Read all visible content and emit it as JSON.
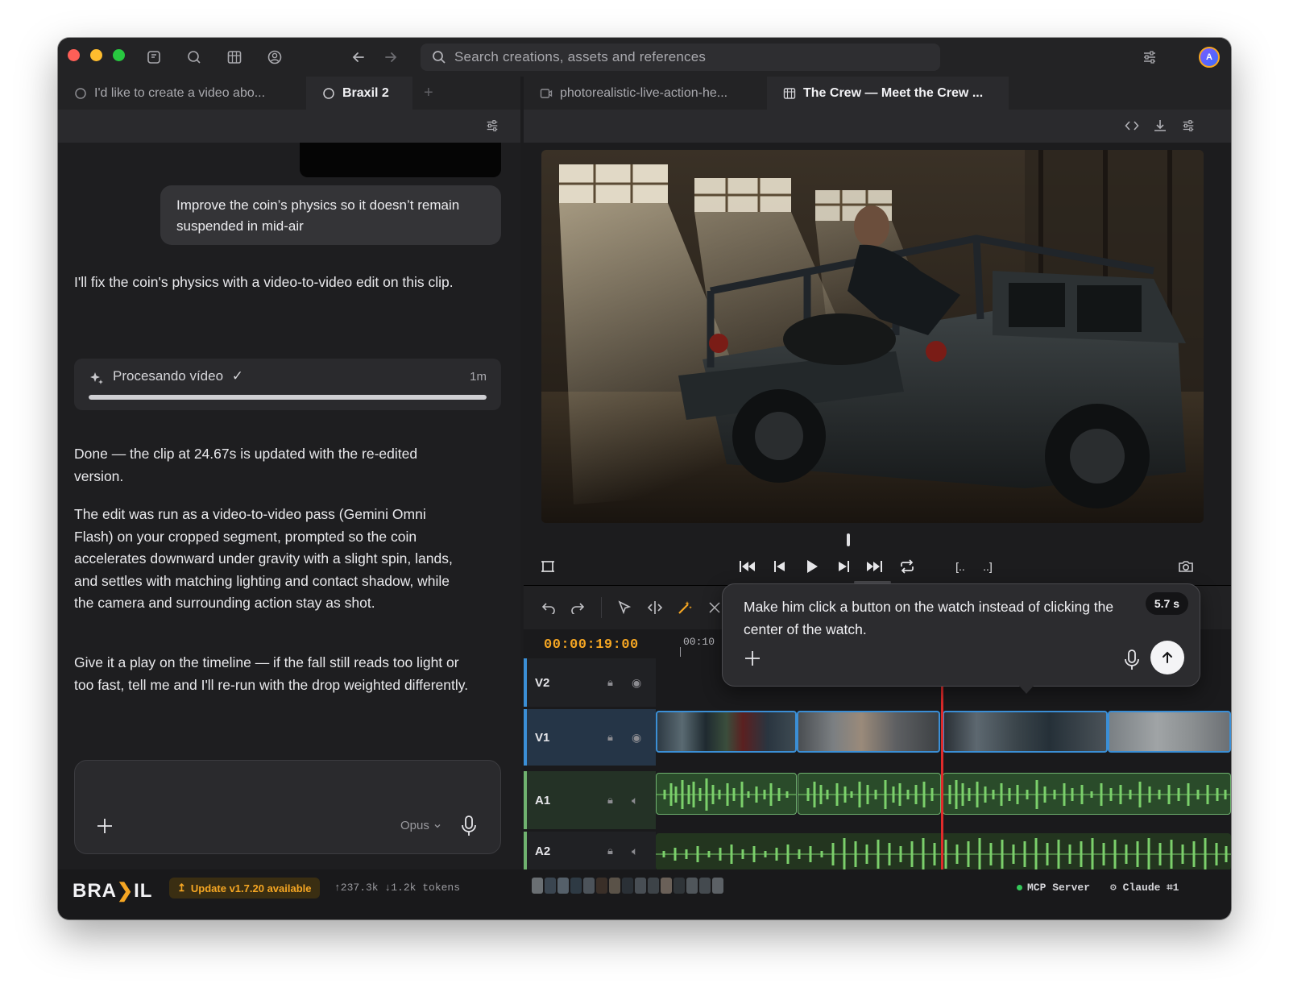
{
  "search": {
    "placeholder": "Search creations, assets and references"
  },
  "user": {
    "avatar_initial": "A"
  },
  "left_tabs": [
    {
      "label": "I'd like to create a video abo..."
    },
    {
      "label": "Braxil 2"
    }
  ],
  "right_tabs": [
    {
      "label": "photorealistic-live-action-he..."
    },
    {
      "label": "The Crew — Meet the Crew ..."
    }
  ],
  "chat": {
    "user_message": "Improve the coin’s physics so it doesn’t remain suspended in mid-air",
    "assistant_intro": "I'll fix the coin's physics with a video-to-video edit on this clip.",
    "processing": {
      "label": "Procesando vídeo",
      "time": "1m",
      "progress": 1.0
    },
    "done_message": "Done — the clip at 24.67s is updated with the re-edited version.",
    "detail_message": "The edit was run as a video-to-video pass (Gemini Omni Flash) on your cropped segment, prompted so the coin accelerates downward under gravity with a slight spin, lands, and settles with matching lighting and contact shadow, while the camera and surrounding action stay as shot.",
    "followup_message": "Give it a play on the timeline — if the fall still reads too light or too fast, tell me and I'll re-run with the drop weighted differently.",
    "composer": {
      "placeholder": "",
      "model": "Opus"
    }
  },
  "timeline": {
    "timecode": "00:00:19:00",
    "ruler_label": "00:10",
    "tracks": [
      {
        "name": "V2",
        "type": "video"
      },
      {
        "name": "V1",
        "type": "video"
      },
      {
        "name": "A1",
        "type": "audio"
      },
      {
        "name": "A2",
        "type": "audio"
      }
    ]
  },
  "prompt_popup": {
    "text": "Make him click a button on the watch instead of clicking the center of the watch.",
    "duration": "5.7 s"
  },
  "status": {
    "logo": "BRA",
    "logo_tail": "IL",
    "update": "Update v1.7.20 available",
    "tokens": "↑237.3k ↓1.2k tokens",
    "mcp": "MCP Server",
    "claude": "Claude ⌗1"
  },
  "colors": {
    "accent": "#f5a623",
    "playhead": "#e02b2b",
    "video_clip": "#3b8fd6",
    "audio_wave": "#7bd06b",
    "mcp_dot": "#34c759"
  }
}
